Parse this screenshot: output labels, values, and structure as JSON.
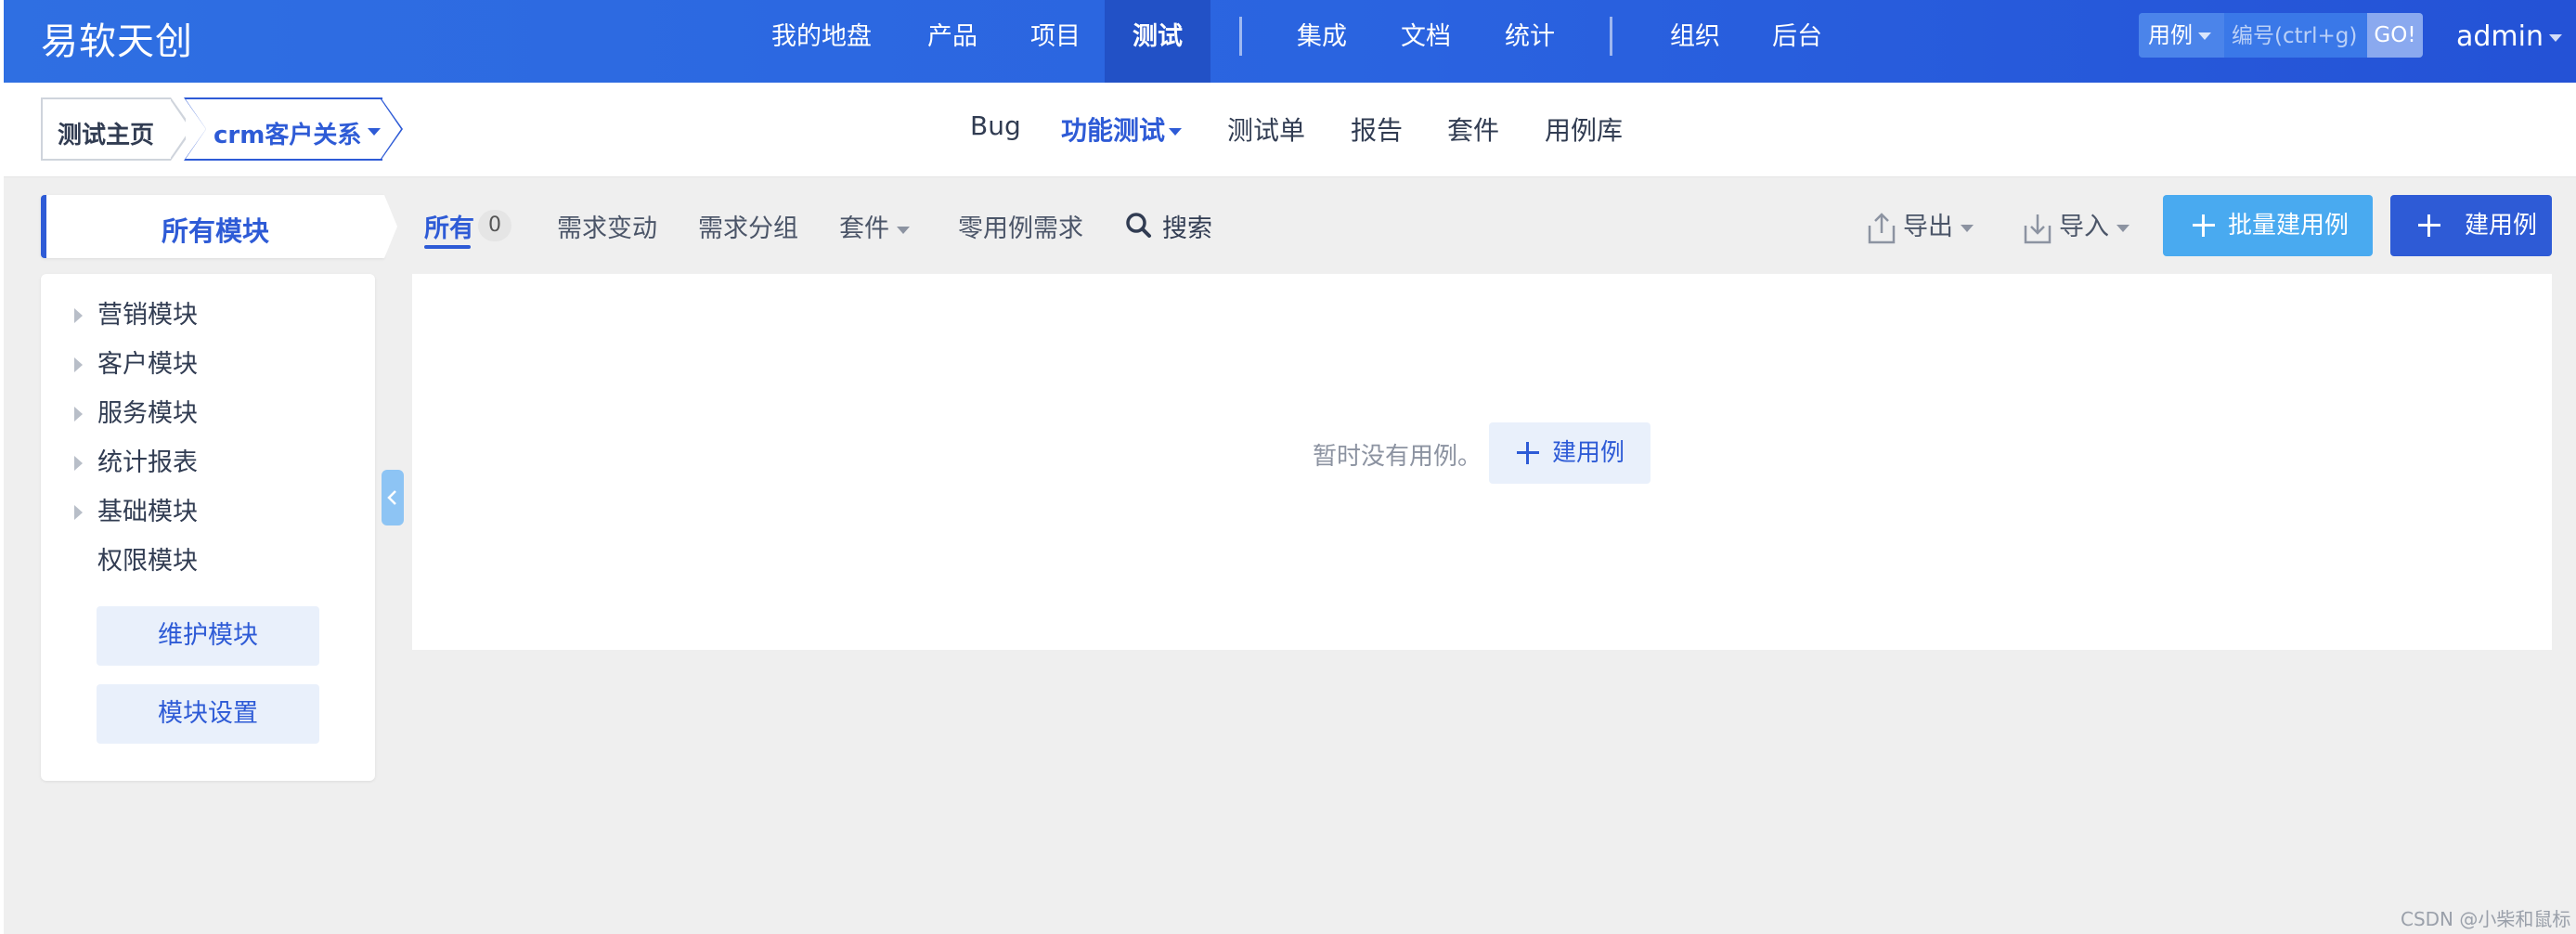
{
  "brand": "易软天创",
  "nav": {
    "items": [
      "我的地盘",
      "产品",
      "项目",
      "测试",
      "集成",
      "文档",
      "统计",
      "组织",
      "后台"
    ],
    "active": "测试"
  },
  "search": {
    "type_label": "用例",
    "placeholder": "编号(ctrl+g)",
    "go_label": "GO!"
  },
  "user": {
    "name": "admin"
  },
  "breadcrumb": {
    "home": "测试主页",
    "product": "crm客户关系"
  },
  "subnav": {
    "items": [
      "Bug",
      "功能测试",
      "测试单",
      "报告",
      "套件",
      "用例库"
    ],
    "active": "功能测试"
  },
  "modules": {
    "title": "所有模块",
    "tree": [
      "营销模块",
      "客户模块",
      "服务模块",
      "统计报表",
      "基础模块",
      "权限模块"
    ],
    "maintain_label": "维护模块",
    "settings_label": "模块设置"
  },
  "feature_bar": {
    "all_label": "所有",
    "all_count": "0",
    "items": [
      "需求变动",
      "需求分组",
      "套件",
      "零用例需求"
    ],
    "search_label": "搜索"
  },
  "toolbar": {
    "export_label": "导出",
    "import_label": "导入",
    "batch_create_label": "批量建用例",
    "create_label": "建用例"
  },
  "empty_state": {
    "message": "暂时没有用例。",
    "create_label": "建用例"
  },
  "watermark": "CSDN @小柴和鼠标",
  "colors": {
    "header_blue": "#2f6fe2",
    "primary": "#2e5bd6",
    "secondary_button": "#49aaf0",
    "background": "#efefef"
  }
}
